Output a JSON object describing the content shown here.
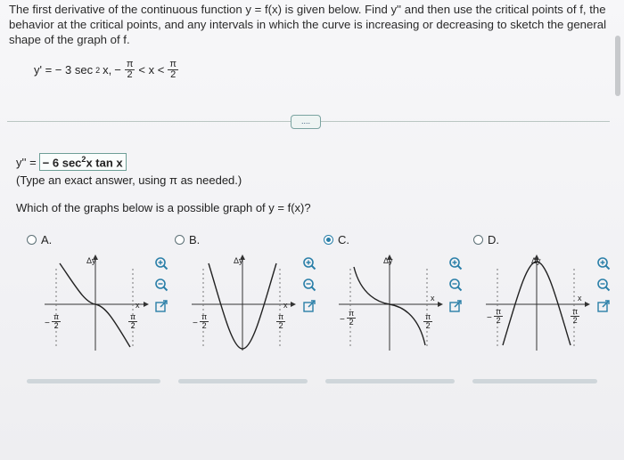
{
  "question": {
    "text": "The first derivative of the continuous function y = f(x) is given below. Find y'' and then use the critical points of f, the behavior at the critical points, and any intervals in which the curve is increasing or decreasing to sketch the general shape of the graph of f."
  },
  "given": {
    "lhs": "y' = − 3 sec",
    "exp": "2",
    "rhs": "x,",
    "neg": "−",
    "pi": "π",
    "two": "2",
    "lt1": "< x <"
  },
  "answer": {
    "prefix": "y'' =",
    "value_a": "− 6 sec",
    "exp": "2",
    "value_b": "x tan x",
    "hint": "(Type an exact answer, using π as needed.)"
  },
  "which": "Which of the graphs below is a possible graph of y = f(x)?",
  "options": [
    {
      "letter": "A.",
      "selected": false
    },
    {
      "letter": "B.",
      "selected": false
    },
    {
      "letter": "C.",
      "selected": true
    },
    {
      "letter": "D.",
      "selected": false
    }
  ],
  "axis": {
    "y_label": "Δy",
    "x_label": "x",
    "neg_left": "−",
    "pi": "π",
    "two": "2"
  },
  "more_label": "....",
  "colors": {
    "accent": "#2a7fa8",
    "border": "#6d9e96"
  },
  "icons": [
    "zoom-in-icon",
    "zoom-out-icon",
    "open-external-icon"
  ]
}
